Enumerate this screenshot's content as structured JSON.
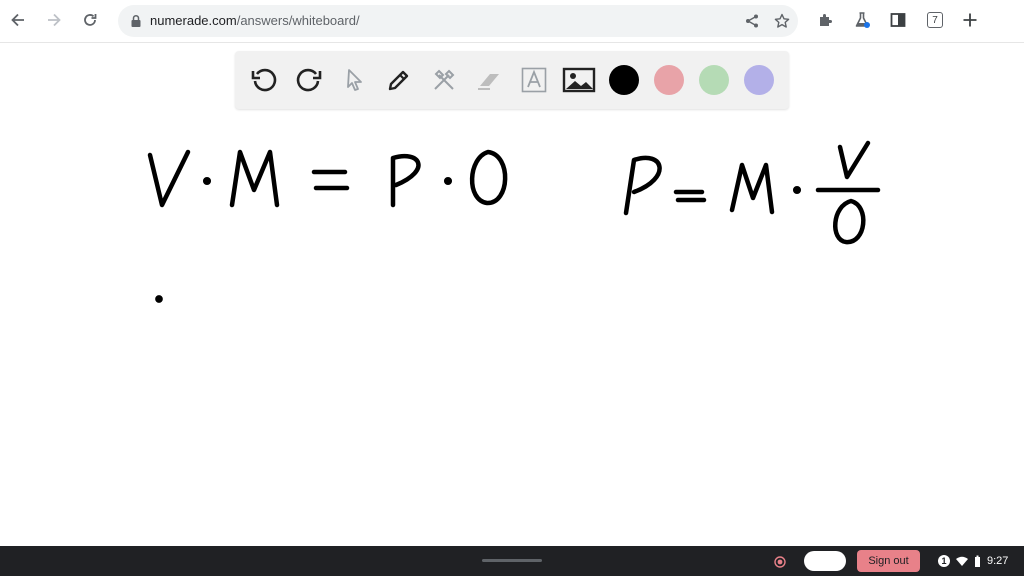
{
  "browser": {
    "url_host": "numerade.com",
    "url_path": "/answers/whiteboard/",
    "tab_count": "7",
    "icons": [
      "back-arrow-icon",
      "forward-arrow-icon",
      "reload-icon",
      "lock-icon",
      "share-icon",
      "bookmark-star-icon",
      "extensions-puzzle-icon",
      "labs-flask-icon",
      "side-panel-icon",
      "tab-count-icon",
      "new-tab-plus-icon"
    ]
  },
  "toolbar": {
    "tools": [
      "undo-icon",
      "redo-icon",
      "select-pointer-icon",
      "pen-icon",
      "tools-icon",
      "eraser-icon",
      "text-icon",
      "image-icon"
    ],
    "colors": [
      "#000000",
      "#e8a3a8",
      "#b5dbb5",
      "#b3b0e8"
    ]
  },
  "whiteboard": {
    "equation_1": "V · M = P · O",
    "equation_2": "P = M · V / O"
  },
  "shelf": {
    "signout_label": "Sign out",
    "notification_count": "1",
    "time": "9:27"
  }
}
